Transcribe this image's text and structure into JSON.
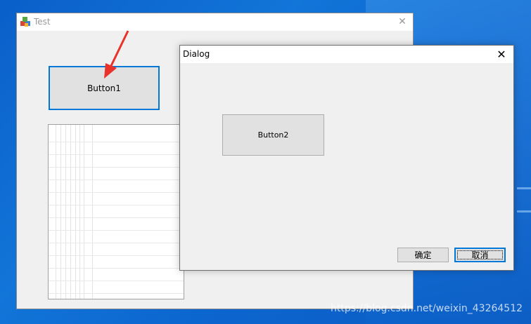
{
  "main_window": {
    "title": "Test",
    "close_glyph": "✕",
    "button1_label": "Button1"
  },
  "dialog": {
    "title": "Dialog",
    "close_glyph": "✕",
    "button2_label": "Button2",
    "ok_label": "确定",
    "cancel_label": "取消"
  },
  "watermark": "https://blog.csdn.net/weixin_43264512",
  "colors": {
    "focus_border": "#0078d7",
    "arrow": "#e8322a",
    "desktop": "#0b66cf"
  }
}
